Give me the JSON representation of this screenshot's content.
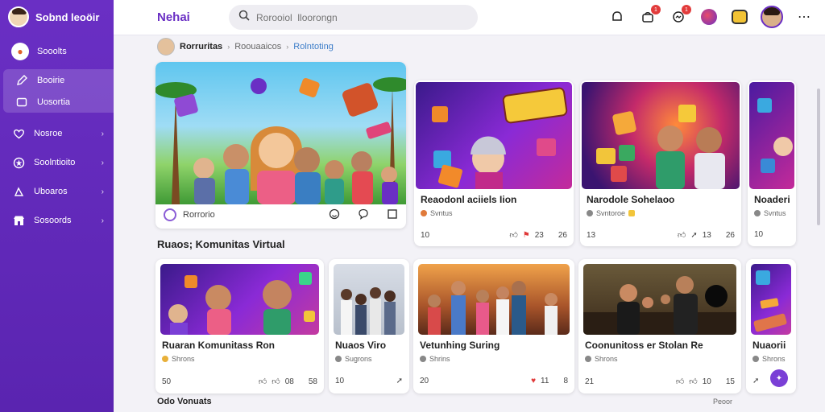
{
  "sidebar": {
    "title": "Sobnd leoöir",
    "items": [
      {
        "label": "Sooolts",
        "icon": "brand-logo-icon"
      },
      {
        "label": "Booirie",
        "icon": "edit-icon"
      },
      {
        "label": "Uosortia",
        "icon": "image-icon"
      },
      {
        "label": "Nosroe",
        "icon": "heart-icon"
      },
      {
        "label": "Soolntioito",
        "icon": "star-icon"
      },
      {
        "label": "Uboaros",
        "icon": "play-icon"
      },
      {
        "label": "Sosoords",
        "icon": "store-icon"
      }
    ]
  },
  "topbar": {
    "brand": "Nehai",
    "search_placeholder": "Rorooiol  lloorongn",
    "badges": {
      "cart": "1",
      "messages": "1"
    }
  },
  "breadcrumb": {
    "c1": "Rorruritas",
    "c2": "Roouaaicos",
    "c3": "Rolntoting"
  },
  "featured": {
    "label": "Rorrorio"
  },
  "row1": [
    {
      "title": "Reaodonl aciiels Iion",
      "sub": "Svntus",
      "views": "10",
      "likes": "23",
      "shares": "26"
    },
    {
      "title": "Narodole Sohelaoo",
      "sub": "Svntoroe",
      "views": "13",
      "likes": "13",
      "shares": "26"
    },
    {
      "title": "Noaderi",
      "sub": "Svntus",
      "views": "10",
      "likes": "",
      "shares": ""
    }
  ],
  "section_title": "Ruaos; Komunitas Virtual",
  "row2": [
    {
      "title": "Ruaran Komunitass Ron",
      "sub": "Shrons",
      "views": "50",
      "likes": "08",
      "shares": "58"
    },
    {
      "title": "Nuaos Viro",
      "sub": "Sugrons",
      "views": "10",
      "likes": "",
      "shares": ""
    },
    {
      "title": "Vetunhing Suring",
      "sub": "Shrins",
      "views": "20",
      "likes": "11",
      "shares": "8"
    },
    {
      "title": "Coonunitoss er Stolan Re",
      "sub": "Shrons",
      "views": "21",
      "likes": "10",
      "shares": "15"
    },
    {
      "title": "Nuaorii",
      "sub": "Shrons",
      "views": "",
      "likes": "",
      "shares": ""
    }
  ],
  "footer": {
    "more_title": "Odo Vonuats",
    "see_all": "Peoor"
  },
  "colors": {
    "accent": "#6a2fc4",
    "badge": "#e23b3b",
    "link": "#3e7ec9"
  }
}
